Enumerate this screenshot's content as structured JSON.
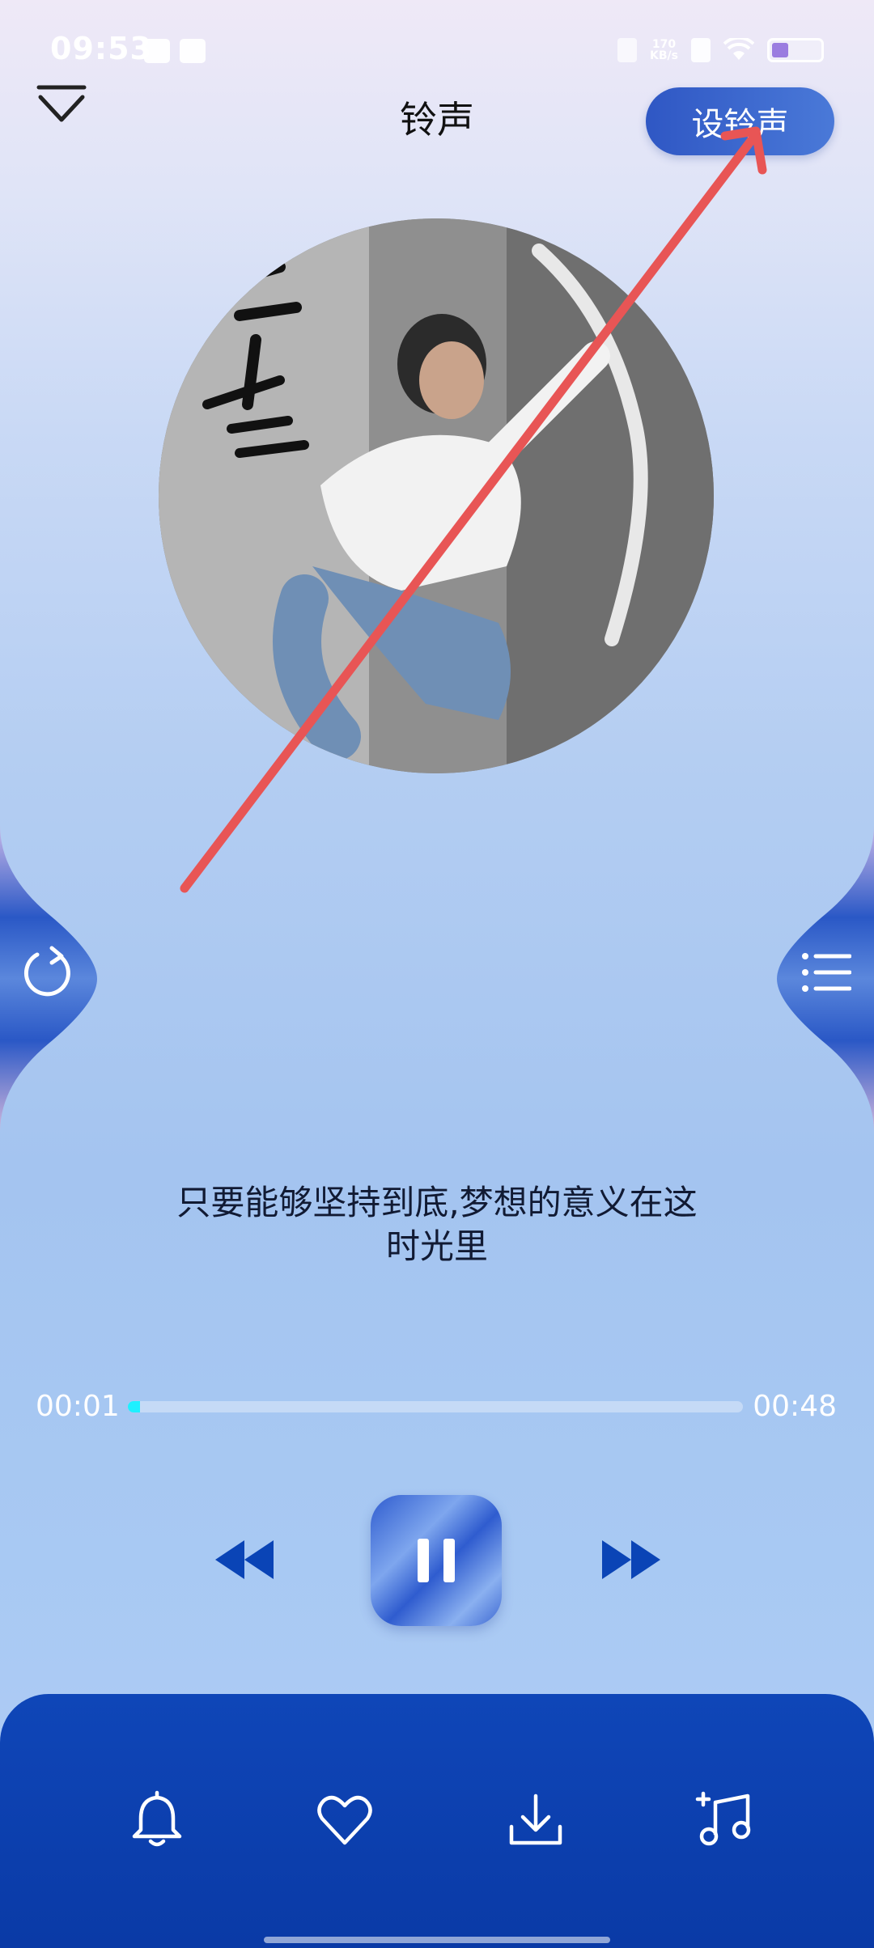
{
  "status_bar": {
    "time": "09:53",
    "net_speed_value": "170",
    "net_speed_unit": "KB/s"
  },
  "header": {
    "title": "铃声",
    "set_ringtone_label": "设铃声"
  },
  "lyric": {
    "line1": "只要能够坚持到底,梦想的意义在这",
    "line2": "时光里"
  },
  "player": {
    "current_time": "00:01",
    "total_time": "00:48",
    "progress_fraction": 0.02
  },
  "bottom_bar": {
    "icons": [
      "bell-icon",
      "heart-icon",
      "download-icon",
      "add-music-icon"
    ]
  },
  "colors": {
    "accent": "#2f57c4",
    "bottom_bar": "#0f46b8",
    "progress": "#1ef0ff",
    "annotation_arrow": "#e85555"
  }
}
